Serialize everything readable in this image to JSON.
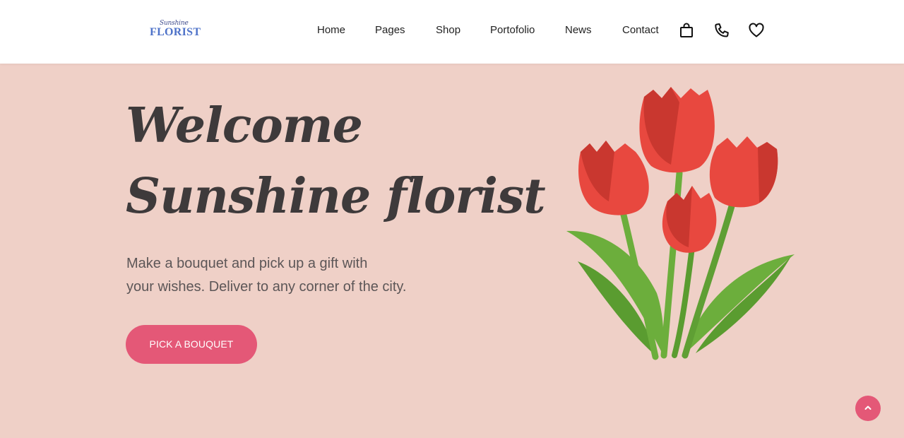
{
  "brand": {
    "script": "Sunshine",
    "word": "FLORIST"
  },
  "nav": {
    "items": [
      "Home",
      "Pages",
      "Shop",
      "Portofolio",
      "News",
      "Contact"
    ],
    "icons": [
      "bag-icon",
      "phone-icon",
      "heart-icon"
    ]
  },
  "hero": {
    "title_line1": "Welcome",
    "title_line2": "Sunshine florist",
    "subtitle_line1": "Make a bouquet and pick up a gift with",
    "subtitle_line2": "your wishes. Deliver to any corner of the city.",
    "cta_label": "PICK A BOUQUET"
  },
  "scroll_top": {
    "label": "^"
  },
  "colors": {
    "background": "#efd0c7",
    "accent": "#e45877",
    "title": "#3e3a3b",
    "text": "#5c5657",
    "tulip_red": "#e8483f",
    "tulip_dark": "#c9372f",
    "stem_green": "#6cae3c"
  }
}
